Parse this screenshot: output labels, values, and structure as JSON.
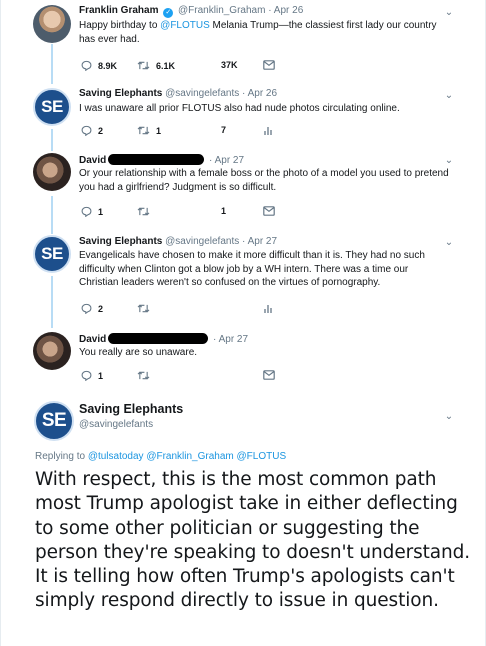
{
  "thread": [
    {
      "name": "Franklin Graham",
      "verified": true,
      "handle": "@Franklin_Graham",
      "date": "Apr 26",
      "text_before": "Happy birthday to ",
      "mention": "@FLOTUS",
      "text_after": " Melania Trump—the classiest first lady our country has ever had.",
      "replies": "8.9K",
      "retweets": "6.1K",
      "likes": "37K"
    },
    {
      "name": "Saving Elephants",
      "avatar_text": "SE",
      "handle": "@savingelefants",
      "date": "Apr 26",
      "text": "I was unaware all prior FLOTUS also had nude photos circulating online.",
      "replies": "2",
      "retweets": "1",
      "likes": "7"
    },
    {
      "name": "David",
      "date": "Apr 27",
      "text": "Or your relationship with a female boss or the photo of a model you used to pretend you had a girlfriend? Judgment is so difficult.",
      "replies": "1",
      "retweets": "",
      "likes": "1"
    },
    {
      "name": "Saving Elephants",
      "avatar_text": "SE",
      "handle": "@savingelefants",
      "date": "Apr 27",
      "text": "Evangelicals have chosen to make it more difficult than it is.  They had no such difficulty when Clinton got a blow job by a WH intern. There was a time our Christian leaders weren't so confused on the virtues of pornography.",
      "replies": "2",
      "retweets": "",
      "likes": ""
    },
    {
      "name": "David",
      "date": "Apr 27",
      "text": "You really are so unaware.",
      "replies": "1",
      "retweets": "",
      "likes": ""
    }
  ],
  "main": {
    "avatar_text": "SE",
    "name": "Saving Elephants",
    "handle": "@savingelefants",
    "replying_label": "Replying to ",
    "replying_mentions": "@tulsatoday @Franklin_Graham @FLOTUS",
    "text": "With respect, this is the most common path most Trump apologist take in either deflecting to some other politician or suggesting the person they're speaking to doesn't understand. It is telling how often Trump's apologists can't simply respond directly to issue in question."
  },
  "colors": {
    "accent": "#1da1f2",
    "mention": "#1b95e0",
    "thread_line": "#b8dcf5",
    "muted": "#657786",
    "avatar_se": "#1d4f8c"
  },
  "icons": [
    "reply-icon",
    "retweet-icon",
    "like-icon",
    "message-icon",
    "analytics-icon",
    "chevron-down-icon",
    "verified-icon"
  ]
}
